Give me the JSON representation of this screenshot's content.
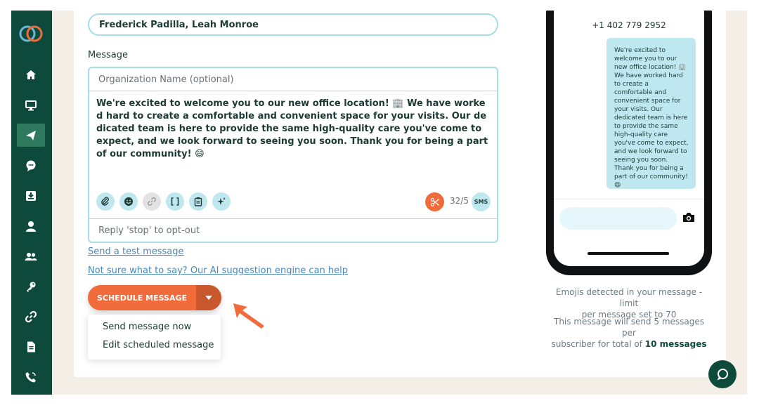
{
  "sidebar": {
    "logo": "app-logo",
    "items": [
      {
        "icon": "home-icon",
        "active": false
      },
      {
        "icon": "monitor-icon",
        "active": false
      },
      {
        "icon": "send-icon",
        "active": true
      },
      {
        "icon": "chat-bubble-icon",
        "active": false
      },
      {
        "icon": "inbox-download-icon",
        "active": false
      },
      {
        "icon": "user-icon",
        "active": false
      },
      {
        "icon": "users-icon",
        "active": false
      },
      {
        "icon": "key-icon",
        "active": false
      },
      {
        "icon": "link-icon",
        "active": false
      },
      {
        "icon": "document-icon",
        "active": false
      },
      {
        "icon": "phone-call-icon",
        "active": false
      }
    ]
  },
  "recipients": {
    "value": "Frederick Padilla, Leah Monroe"
  },
  "message": {
    "label": "Message",
    "org_placeholder": "Organization Name (optional)",
    "body": "We're excited to welcome you to our new office location! 🏢 We have worked hard to create a comfortable and convenient space for your visits. Our dedicated team is here to provide the same high-quality care you've come to expect, and we look forward to seeing you soon. Thank you for being a part of our community! 😄",
    "count": "32/5",
    "sms_badge": "SMS",
    "optout": "Reply 'stop' to opt-out"
  },
  "links": {
    "test_message": "Send a test message",
    "ai_suggestion": "Not sure what to say? Our AI suggestion engine can help"
  },
  "schedule": {
    "button_label": "SCHEDULE MESSAGE",
    "menu": [
      "Send message now",
      "Edit scheduled message"
    ]
  },
  "preview": {
    "phone_number": "+1 402 779 2952",
    "bubble": "We're excited to welcome you to our new office location! 🏢 We have worked hard to create a comfortable and convenient space for your visits. Our dedicated team is here to provide the same high-quality care you've come to expect, and we look forward to seeing you soon. Thank you for being a part of our community! 😄"
  },
  "notes": {
    "emoji_line1": "Emojis detected in your message - limit",
    "emoji_line2": "per message set to 70",
    "count_line1": "This message will send 5 messages per",
    "count_line2_prefix": "subscriber for total of ",
    "count_line2_bold": "10 messages"
  },
  "colors": {
    "sidebar": "#0e4a3c",
    "accent": "#f26b3a",
    "border": "#a9dde6",
    "bubble": "#bfe7ef"
  }
}
